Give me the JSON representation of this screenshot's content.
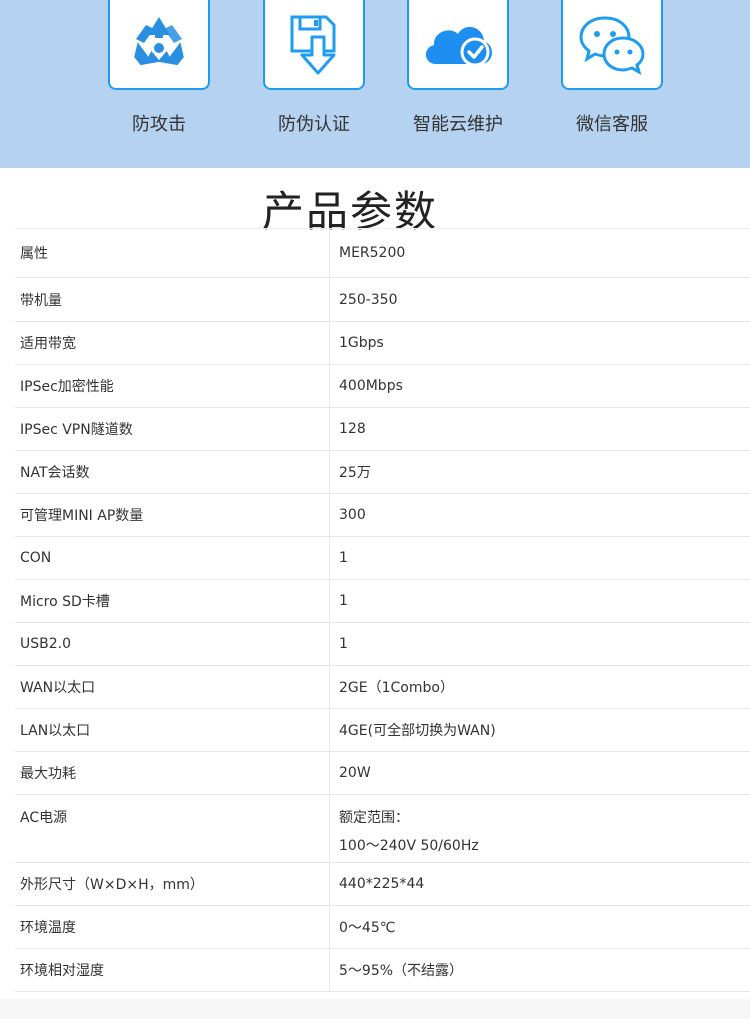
{
  "features": [
    {
      "label": "防攻击",
      "icon": "recycle-icon"
    },
    {
      "label": "防伪认证",
      "icon": "download-doc-icon"
    },
    {
      "label": "智能云维护",
      "icon": "cloud-check-icon"
    },
    {
      "label": "微信客服",
      "icon": "wechat-icon"
    }
  ],
  "title": "产品参数",
  "spec_header": {
    "key": "属性",
    "value": "MER5200"
  },
  "specs": [
    {
      "key": "带机量",
      "value": "250-350"
    },
    {
      "key": "适用带宽",
      "value": "1Gbps"
    },
    {
      "key": "IPSec加密性能",
      "value": "400Mbps"
    },
    {
      "key": "IPSec VPN隧道数",
      "value": "128"
    },
    {
      "key": "NAT会话数",
      "value": "25万"
    },
    {
      "key": "可管理MINI AP数量",
      "value": "300"
    },
    {
      "key": "CON",
      "value": "1"
    },
    {
      "key": "Micro SD卡槽",
      "value": "1"
    },
    {
      "key": "USB2.0",
      "value": "1"
    },
    {
      "key": "WAN以太口",
      "value": "2GE（1Combo）"
    },
    {
      "key": "LAN以太口",
      "value": "4GE(可全部切换为WAN)"
    },
    {
      "key": "最大功耗",
      "value": "20W"
    },
    {
      "key": "AC电源",
      "value": "额定范围：",
      "value2": "100～240V 50/60Hz"
    },
    {
      "key": "外形尺寸（W×D×H，mm）",
      "value": "440*225*44"
    },
    {
      "key": "环境温度",
      "value": "0～45℃"
    },
    {
      "key": "环境相对湿度",
      "value": "5～95%（不结露）"
    }
  ],
  "colors": {
    "banner": "#b5d3f0",
    "accent": "#1e9cf0",
    "recycle": "#2a8fe0",
    "cloud": "#1f8ef1"
  }
}
